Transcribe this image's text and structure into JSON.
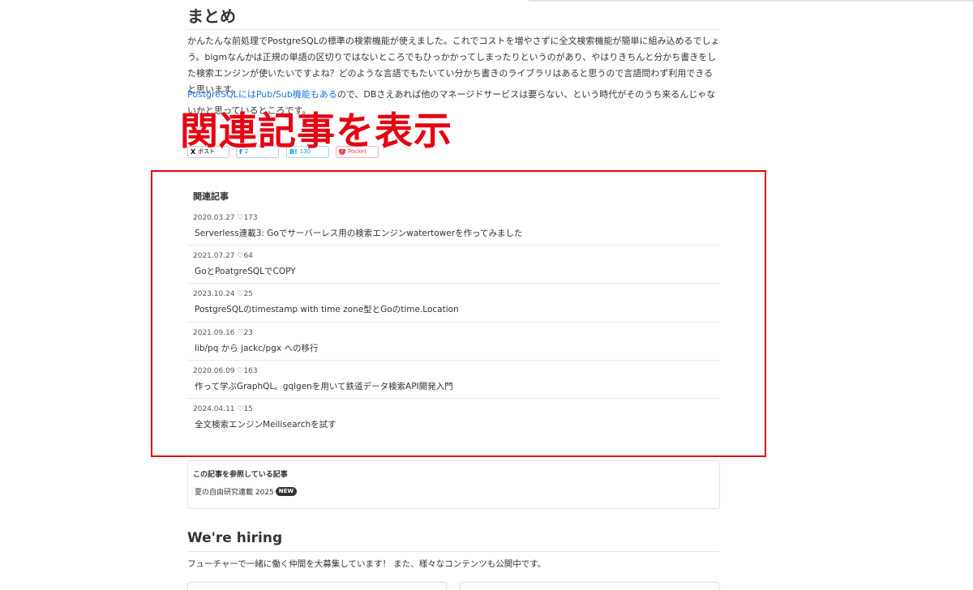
{
  "summary": {
    "heading": "まとめ",
    "para1": "かんたんな前処理でPostgreSQLの標準の検索機能が使えました。これでコストを増やさずに全文検索機能が簡単に組み込めるでしょう。bigmなんかは正規の単語の区切りではないところでもひっかかってしまったりというのがあり、やはりきちんと分かち書きをした検索エンジンが使いたいですよね？どのような言語でもたいてい分かち書きのライブラリはあると思うので言語問わず利用できると思います。",
    "para2_link": "PostgreSQLにはPub/Sub機能もある",
    "para2_rest": "ので、DBさえあれば他のマネージドサービスは要らない、という時代がそのうち来るんじゃないかと思っているところです。"
  },
  "annotation": "関連記事を表示",
  "share": {
    "x_icon": "X",
    "x_label": "ポスト",
    "fb_icon": "f",
    "fb_count": "2",
    "hb_icon": "B!",
    "hb_count": "130",
    "pocket_label": "Pocket"
  },
  "related": {
    "title": "関連記事",
    "items": [
      {
        "meta": "2020.03.27 ♡173",
        "title": "Serverless連載3: Goでサーバーレス用の検索エンジンwatertowerを作ってみました"
      },
      {
        "meta": "2021.07.27 ♡64",
        "title": "GoとPoatgreSQLでCOPY"
      },
      {
        "meta": "2023.10.24 ♡25",
        "title": "PostgreSQLのtimestamp with time zone型とGoのtime.Location"
      },
      {
        "meta": "2021.09.16 ♡23",
        "title": "lib/pq から jackc/pgx への移行"
      },
      {
        "meta": "2020.06.09 ♡163",
        "title": "作って学ぶGraphQL。gqlgenを用いて鉄道データ検索API開発入門"
      },
      {
        "meta": "2024.04.11 ♡15",
        "title": "全文検索エンジンMeilisearchを試す"
      }
    ]
  },
  "references": {
    "title": "この記事を参照している記事",
    "item": "夏の自由研究連載 2025",
    "badge": "NEW"
  },
  "hiring": {
    "heading": "We're hiring",
    "text": "フューチャーで一緒に働く仲間を大募集しています！ また、様々なコンテンツも公開中です。"
  },
  "colors": {
    "accent": "#e60012",
    "link": "#1a73e8"
  }
}
